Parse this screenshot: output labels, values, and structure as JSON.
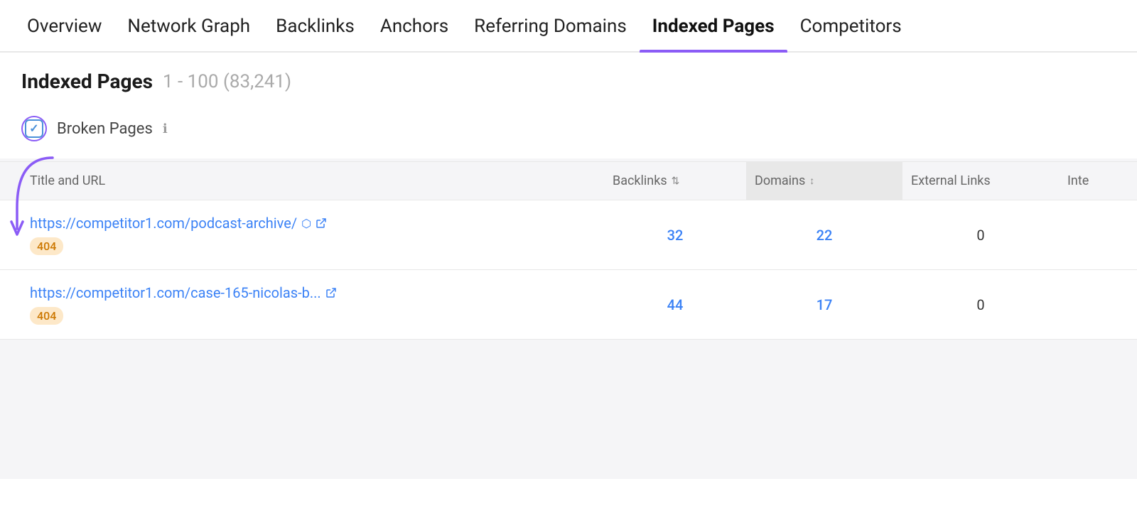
{
  "nav": {
    "tabs": [
      {
        "id": "overview",
        "label": "Overview",
        "active": false
      },
      {
        "id": "network-graph",
        "label": "Network Graph",
        "active": false
      },
      {
        "id": "backlinks",
        "label": "Backlinks",
        "active": false
      },
      {
        "id": "anchors",
        "label": "Anchors",
        "active": false
      },
      {
        "id": "referring-domains",
        "label": "Referring Domains",
        "active": false
      },
      {
        "id": "indexed-pages",
        "label": "Indexed Pages",
        "active": true
      },
      {
        "id": "competitors",
        "label": "Competitors",
        "active": false
      }
    ]
  },
  "page": {
    "title": "Indexed Pages",
    "range": "1 - 100 (83,241)"
  },
  "filter": {
    "label": "Broken Pages",
    "info_label": "ℹ",
    "checked": true
  },
  "table": {
    "columns": [
      {
        "id": "title-url",
        "label": "Title and URL",
        "sortable": false,
        "sorted": false
      },
      {
        "id": "backlinks",
        "label": "Backlinks",
        "sortable": true,
        "sorted": false
      },
      {
        "id": "domains",
        "label": "Domains",
        "sortable": true,
        "sorted": true
      },
      {
        "id": "external-links",
        "label": "External Links",
        "sortable": false,
        "sorted": false
      },
      {
        "id": "inte",
        "label": "Inte",
        "sortable": false,
        "sorted": false
      }
    ],
    "rows": [
      {
        "url": "https://competitor1.com/podcast-archive/",
        "url_display": "https://competitor1.com/podcast-archive/",
        "badge": "404",
        "backlinks": "32",
        "domains": "22",
        "external_links": "0"
      },
      {
        "url": "https://competitor1.com/case-165-nicolas-b...",
        "url_display": "https://competitor1.com/case-165-nicolas-b...",
        "badge": "404",
        "backlinks": "44",
        "domains": "17",
        "external_links": "0"
      }
    ]
  },
  "icons": {
    "external_link": "↗",
    "sort": "⇅",
    "sort_active": "↕",
    "check": "✓"
  }
}
